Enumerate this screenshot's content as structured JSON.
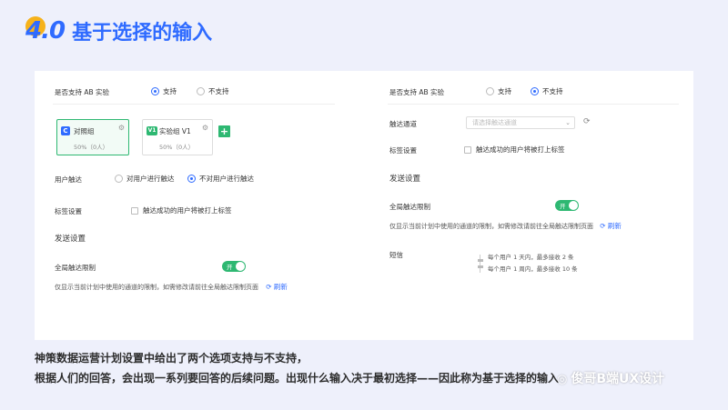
{
  "header": {
    "number": "4.0",
    "title": "基于选择的输入"
  },
  "left": {
    "ab_label": "是否支持 AB 实验",
    "ab_options": [
      "支持",
      "不支持"
    ],
    "groups": [
      {
        "badge": "C",
        "name": "对照组",
        "sub": "50%（0人）",
        "color": "#2f6bff"
      },
      {
        "badge": "V1",
        "name": "实验组 V1",
        "sub": "50%（0人）",
        "color": "#2eb872"
      }
    ],
    "add_label": "+",
    "reach_label": "用户触达",
    "reach_options": [
      "对用户进行触达",
      "不对用户进行触达"
    ],
    "tag_label": "标签设置",
    "tag_check": "触达成功的用户将被打上标签",
    "send_heading": "发送设置",
    "limit_label": "全局触达限制",
    "toggle_text": "开",
    "limit_note": "仅显示当前计划中使用的通道的限制，如需修改请前往全局触达限制页面",
    "refresh_label": "刷新"
  },
  "right": {
    "ab_label": "是否支持 AB 实验",
    "ab_options": [
      "支持",
      "不支持"
    ],
    "channel_label": "触达通道",
    "channel_placeholder": "请选择触达通道",
    "tag_label": "标签设置",
    "tag_check": "触达成功的用户将被打上标签",
    "send_heading": "发送设置",
    "limit_label": "全局触达限制",
    "toggle_text": "开",
    "limit_note": "仅显示当前计划中使用的通道的限制，如需修改请前往全局触达限制页面",
    "refresh_label": "刷新",
    "sms_label": "短信",
    "sms_rules": [
      "每个用户 1 天内，最多接收 2 条",
      "每个用户 1 周内，最多接收 10 条"
    ]
  },
  "caption": {
    "line1": "神策数据运营计划设置中给出了两个选项支持与不支持，",
    "line2": "根据人们的回答，会出现一系列要回答的后续问题。出现什么输入决于最初选择——因此称为基于选择的输入"
  },
  "watermark": "俊哥B端UX设计"
}
